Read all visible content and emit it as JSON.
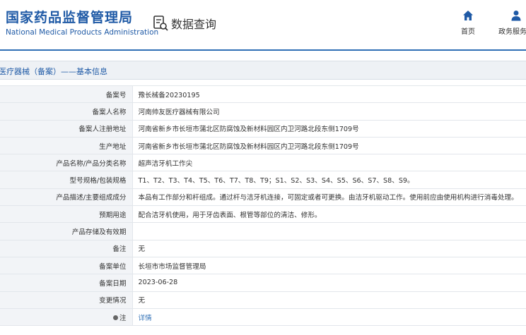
{
  "header": {
    "org_name_cn": "国家药品监督管理局",
    "org_name_en": "National Medical Products Administration",
    "query_label": "数据查询",
    "nav": [
      {
        "label": "首页",
        "icon": "home-icon"
      },
      {
        "label": "政务服务门",
        "icon": "user-icon"
      }
    ]
  },
  "section_title": "医疗器械（备案）——基本信息",
  "rows": [
    {
      "key": "备案号",
      "value": "豫长械备20230195"
    },
    {
      "key": "备案人名称",
      "value": "河南帅友医疗器械有限公司"
    },
    {
      "key": "备案人注册地址",
      "value": "河南省新乡市长垣市蒲北区防腐蚀及新材料园区内卫河路北段东侧1709号"
    },
    {
      "key": "生产地址",
      "value": "河南省新乡市长垣市蒲北区防腐蚀及新材料园区内卫河路北段东侧1709号"
    },
    {
      "key": "产品名称/产品分类名称",
      "value": "超声洁牙机工作尖"
    },
    {
      "key": "型号规格/包装规格",
      "value": "T1、T2、T3、T4、T5、T6、T7、T8、T9；S1、S2、S3、S4、S5、S6、S7、S8、S9。"
    },
    {
      "key": "产品描述/主要组成成分",
      "value": "本品有工作部分和杆组成。通过杆与洁牙机连接，可固定或者可更换。由洁牙机驱动工作。使用前应由使用机构进行消毒处理。"
    },
    {
      "key": "预期用途",
      "value": "配合洁牙机使用，用于牙齿表面、根管等部位的清洁、修形。"
    },
    {
      "key": "产品存储及有效期",
      "value": ""
    },
    {
      "key": "备注",
      "value": "无"
    },
    {
      "key": "备案单位",
      "value": "长垣市市场监督管理局"
    },
    {
      "key": "备案日期",
      "value": "2023-06-28"
    },
    {
      "key": "变更情况",
      "value": "无"
    }
  ],
  "note_row": {
    "key": "注",
    "value": "详情"
  }
}
